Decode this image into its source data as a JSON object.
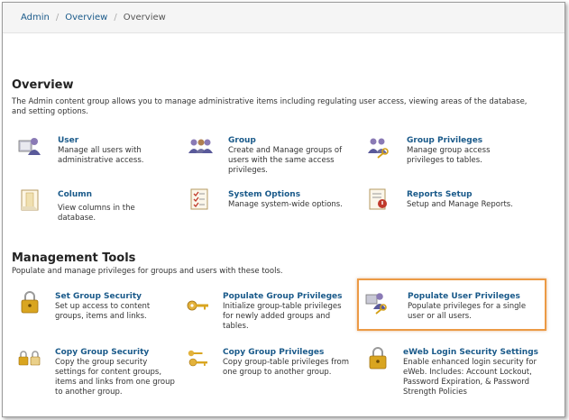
{
  "breadcrumb": {
    "items": [
      "Admin",
      "Overview"
    ],
    "current": "Overview"
  },
  "overview": {
    "title": "Overview",
    "description": "The Admin content group allows you to manage administrative items including regulating user access, viewing areas of the database, and setting options.",
    "items": [
      {
        "title": "User",
        "text": "Manage all users with administrative access.",
        "icon": "user-icon"
      },
      {
        "title": "Group",
        "text": "Create and Manage groups of users with the same access privileges.",
        "icon": "group-icon"
      },
      {
        "title": "Group Privileges",
        "text": "Manage group access privileges to tables.",
        "icon": "group-privileges-icon"
      },
      {
        "title": "Column",
        "text": "View columns in the database.",
        "icon": "column-icon"
      },
      {
        "title": "System Options",
        "text": "Manage system-wide options.",
        "icon": "system-options-icon"
      },
      {
        "title": "Reports Setup",
        "text": "Setup and Manage Reports.",
        "icon": "reports-icon"
      }
    ]
  },
  "tools": {
    "title": "Management Tools",
    "description": "Populate and manage privileges for groups and users with these tools.",
    "items": [
      {
        "title": "Set Group Security",
        "text": "Set up access to content groups, items and links.",
        "icon": "lock-icon"
      },
      {
        "title": "Populate Group Privileges",
        "text": "Initialize group-table privileges for newly added groups and tables.",
        "icon": "key-icon"
      },
      {
        "title": "Populate User Privileges",
        "text": "Populate privileges for a single user or all users.",
        "icon": "user-key-icon"
      },
      {
        "title": "Copy Group Security",
        "text": "Copy the group security settings for content groups, items and links from one group to another group.",
        "icon": "copy-lock-icon"
      },
      {
        "title": "Copy Group Privileges",
        "text": "Copy group-table privileges from one group to another group.",
        "icon": "copy-key-icon"
      },
      {
        "title": "eWeb Login Security Settings",
        "text": "Enable enhanced login security for eWeb. Includes: Account Lockout, Password Expiration, & Password Strength Policies",
        "icon": "padlock-icon"
      }
    ]
  }
}
